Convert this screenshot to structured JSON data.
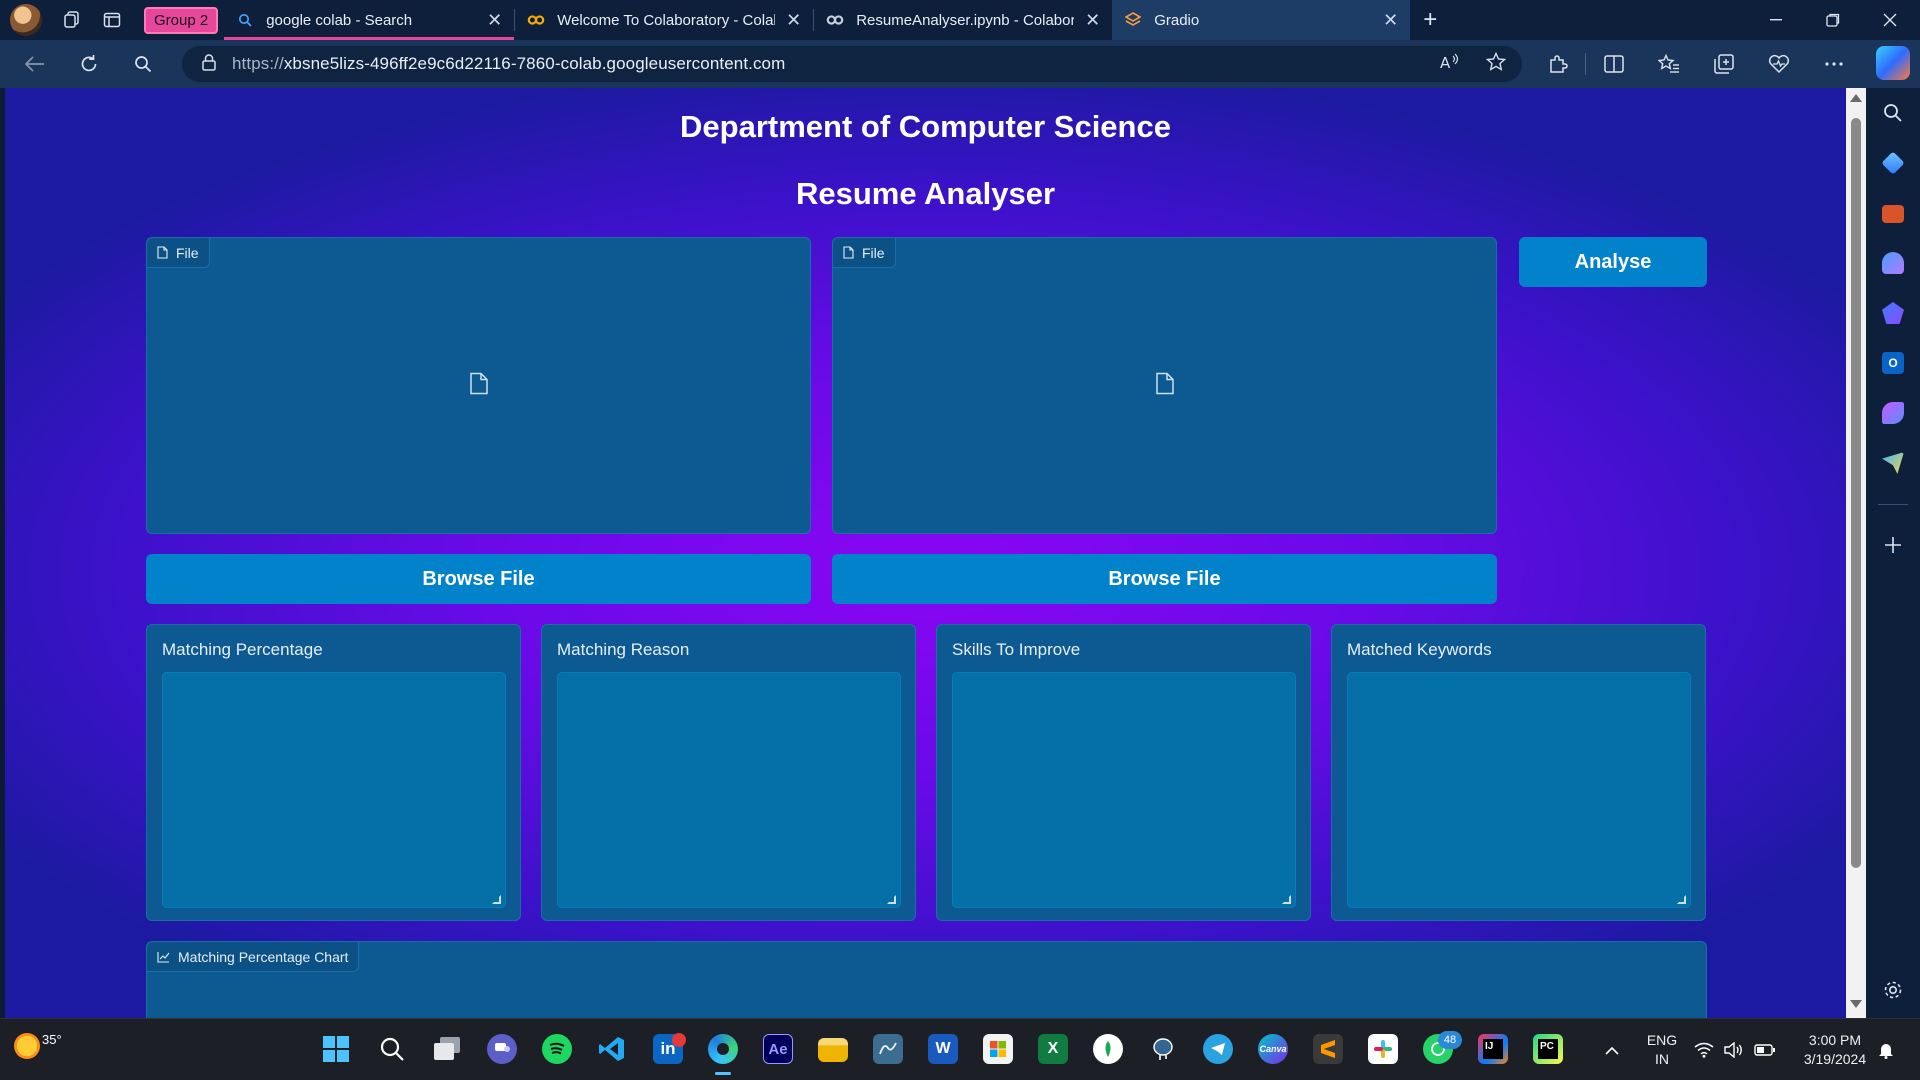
{
  "browser": {
    "tab_group_label": "Group 2",
    "tabs": [
      {
        "title": "google colab - Search",
        "icon": "search-icon"
      },
      {
        "title": "Welcome To Colaboratory - Colab",
        "icon": "colab-logo-icon"
      },
      {
        "title": "ResumeAnalyser.ipynb - Colaboratory",
        "icon": "colab-logo-icon"
      },
      {
        "title": "Gradio",
        "icon": "gradio-logo-icon"
      }
    ],
    "url": "https://xbsne5lizs-496ff2e9c6d22116-7860-colab.googleusercontent.com",
    "url_scheme": "https://",
    "url_host": "xbsne5lizs-496ff2e9c6d22116-7860-colab.googleusercontent.com"
  },
  "page": {
    "title": "Department of Computer Science",
    "subtitle": "Resume Analyser",
    "file_inputs": [
      {
        "label": "File",
        "button": "Browse File"
      },
      {
        "label": "File",
        "button": "Browse File"
      }
    ],
    "analyse_button": "Analyse",
    "outputs": [
      {
        "label": "Matching Percentage",
        "value": ""
      },
      {
        "label": "Matching Reason",
        "value": ""
      },
      {
        "label": "Skills To Improve",
        "value": ""
      },
      {
        "label": "Matched Keywords",
        "value": ""
      }
    ],
    "chart_label": "Matching Percentage Chart"
  },
  "taskbar": {
    "weather_temp": "35°",
    "apps": [
      "windows-start",
      "search",
      "task-view",
      "teams",
      "spotify",
      "vscode",
      "linkedin",
      "edge",
      "after-effects",
      "file-explorer",
      "mysql-workbench",
      "word",
      "microsoft-store",
      "excel",
      "mongodb-compass",
      "postgresql",
      "telegram",
      "canva",
      "sublime-text",
      "slack",
      "whatsapp",
      "intellij",
      "pycharm"
    ],
    "whatsapp_badge": "48",
    "lang_primary": "ENG",
    "lang_secondary": "IN",
    "time": "3:00 PM",
    "date": "3/19/2024"
  },
  "colors": {
    "accent_button": "#0382cc",
    "panel": "#0d5a92",
    "group_pink": "#e6479a"
  }
}
